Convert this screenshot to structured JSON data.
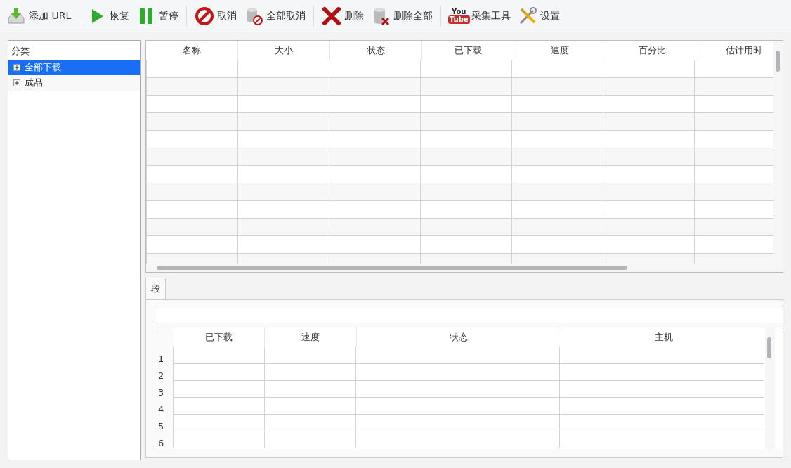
{
  "toolbar": [
    [
      {
        "kind": "download",
        "label": "添加 URL"
      }
    ],
    [
      {
        "kind": "play",
        "label": "恢复"
      },
      {
        "kind": "pause",
        "label": "暂停"
      }
    ],
    [
      {
        "kind": "cancel",
        "label": "取消"
      },
      {
        "kind": "cancel-all",
        "label": "全部取消"
      }
    ],
    [
      {
        "kind": "delete",
        "label": "删除"
      },
      {
        "kind": "delete-all",
        "label": "删除全部"
      }
    ],
    [
      {
        "kind": "video",
        "label": "采集工具",
        "icon_text": [
          "You",
          "Tube"
        ]
      },
      {
        "kind": "settings",
        "label": "设置"
      }
    ]
  ],
  "sidebar": {
    "title": "分类",
    "items": [
      {
        "label": "全部下载",
        "selected": true,
        "expanded": false
      },
      {
        "label": "成品",
        "selected": false,
        "expanded": false
      }
    ]
  },
  "downloads_table": {
    "columns": [
      "名称",
      "大小",
      "状态",
      "已下载",
      "速度",
      "百分比",
      "估计用时"
    ]
  },
  "details": {
    "tabs": [
      {
        "label": "段",
        "selected": true
      }
    ],
    "segments_table": {
      "columns": [
        "已下载",
        "速度",
        "状态",
        "主机"
      ],
      "row_numbers": [
        "1",
        "2",
        "3",
        "4",
        "5",
        "6"
      ]
    }
  }
}
